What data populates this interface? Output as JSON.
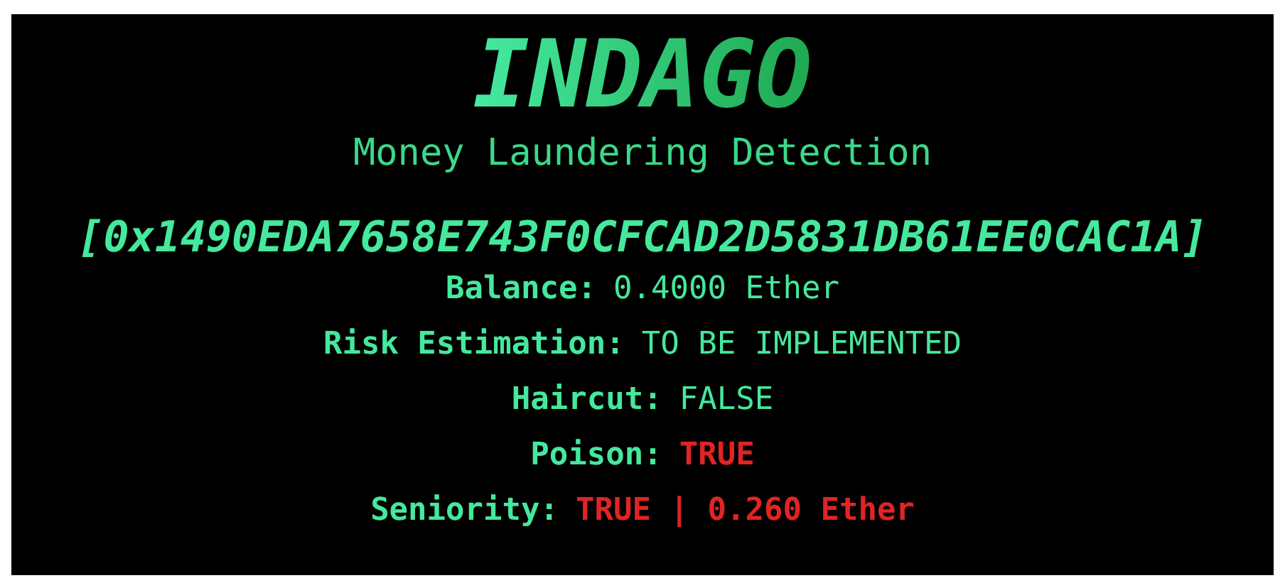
{
  "title": "INDAGO",
  "subtitle": "Money Laundering Detection",
  "address": "[0x1490EDA7658E743F0CFCAD2D5831DB61EE0CAC1A]",
  "fields": [
    {
      "label": "Balance:",
      "value": "0.4000 Ether",
      "flagged": false
    },
    {
      "label": "Risk Estimation:",
      "value": "TO BE IMPLEMENTED",
      "flagged": false
    },
    {
      "label": "Haircut:",
      "value": "FALSE",
      "flagged": false
    },
    {
      "label": "Poison:",
      "value": "TRUE",
      "flagged": true
    },
    {
      "label": "Seniority:",
      "value": "TRUE | 0.260 Ether",
      "flagged": true
    }
  ]
}
